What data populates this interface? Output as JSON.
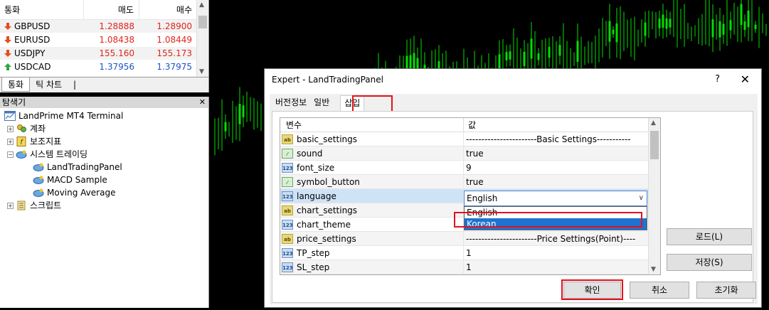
{
  "market_watch": {
    "headers": {
      "symbol": "통화",
      "bid": "매도",
      "ask": "매수"
    },
    "rows": [
      {
        "symbol": "GBPUSD",
        "bid": "1.28888",
        "ask": "1.28900",
        "dir": "down"
      },
      {
        "symbol": "EURUSD",
        "bid": "1.08438",
        "ask": "1.08449",
        "dir": "down"
      },
      {
        "symbol": "USDJPY",
        "bid": "155.160",
        "ask": "155.173",
        "dir": "down"
      },
      {
        "symbol": "USDCAD",
        "bid": "1.37956",
        "ask": "1.37975",
        "dir": "up"
      }
    ],
    "tabs": [
      "통화",
      "틱 차트"
    ]
  },
  "navigator": {
    "title": "탐색기",
    "root": "LandPrime MT4 Terminal",
    "items": {
      "accounts": "계좌",
      "indicators": "보조지표",
      "experts": "시스템 트레이딩",
      "ea1": "LandTradingPanel",
      "ea2": "MACD Sample",
      "ea3": "Moving Average",
      "scripts": "스크립트"
    }
  },
  "dialog": {
    "title": "Expert - LandTradingPanel",
    "help": "?",
    "close": "✕",
    "tabs": [
      "버전정보",
      "일반",
      "삽입"
    ],
    "grid_headers": {
      "variable": "변수",
      "value": "값"
    },
    "rows": [
      {
        "name": "basic_settings",
        "value": "-----------------------Basic Settings-----------",
        "icon": "ab"
      },
      {
        "name": "sound",
        "value": "true",
        "icon": "bool"
      },
      {
        "name": "font_size",
        "value": "9",
        "icon": "num"
      },
      {
        "name": "symbol_button",
        "value": "true",
        "icon": "bool"
      },
      {
        "name": "language",
        "value": "",
        "icon": "num"
      },
      {
        "name": "chart_settings",
        "value": "",
        "icon": "ab"
      },
      {
        "name": "chart_theme",
        "value": "",
        "icon": "num"
      },
      {
        "name": "price_settings",
        "value": "-----------------------Price Settings(Point)----",
        "icon": "ab"
      },
      {
        "name": "TP_step",
        "value": "1",
        "icon": "num"
      },
      {
        "name": "SL_step",
        "value": "1",
        "icon": "num"
      }
    ],
    "combo_value": "English",
    "dropdown_options": [
      "English",
      "Korean"
    ],
    "buttons": {
      "load": "로드(L)",
      "save": "저장(S)",
      "ok": "확인",
      "cancel": "취소",
      "reset": "초기화"
    }
  },
  "colors": {
    "highlight": "#e6101a",
    "chart_bull": "#00e000",
    "select": "#1e73d0"
  }
}
